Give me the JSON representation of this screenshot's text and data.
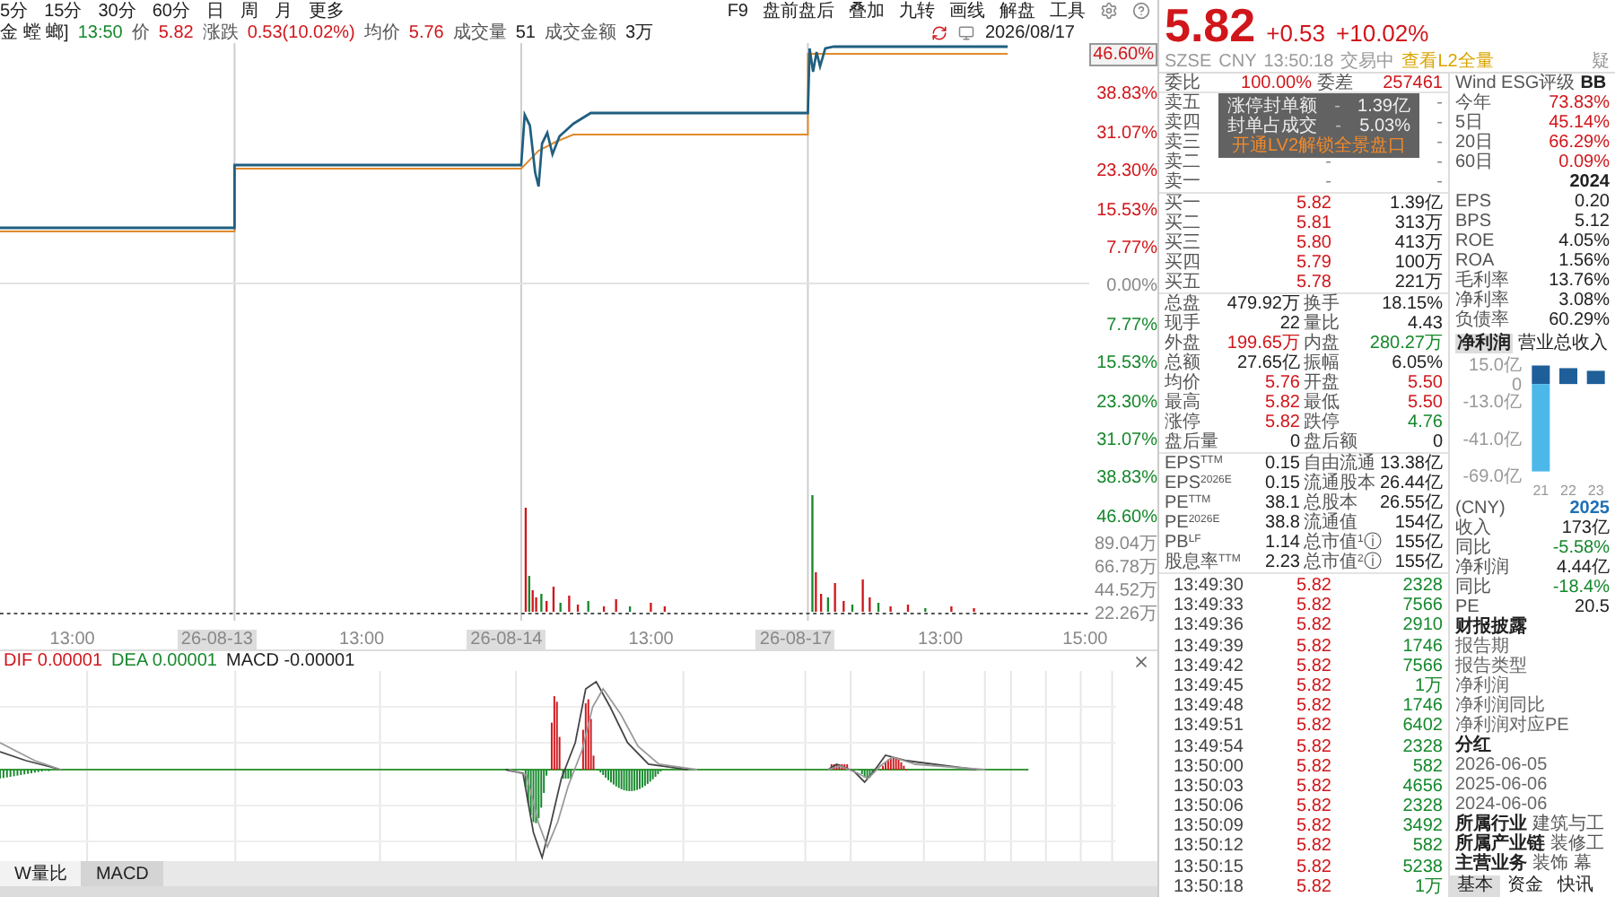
{
  "toolbar": {
    "periods": [
      {
        "label": "5分",
        "selected": false
      },
      {
        "label": "15分",
        "selected": false
      },
      {
        "label": "30分",
        "selected": false
      },
      {
        "label": "60分",
        "selected": false
      },
      {
        "label": "日",
        "selected": false
      },
      {
        "label": "周",
        "selected": false
      },
      {
        "label": "月",
        "selected": false
      },
      {
        "label": "更多",
        "selected": false
      }
    ],
    "tools": [
      "F9",
      "盘前盘后",
      "叠加",
      "九转",
      "画线",
      "解盘",
      "工具"
    ]
  },
  "quote_line": {
    "name": "金 螳 螂]",
    "time": "13:50",
    "items": [
      {
        "label": "价",
        "value": "5.82",
        "color": "#d0161b"
      },
      {
        "label": "涨跌",
        "value": "0.53(10.02%)",
        "color": "#d0161b"
      },
      {
        "label": "均价",
        "value": "5.76",
        "color": "#d0161b"
      },
      {
        "label": "成交量",
        "value": "51",
        "color": "#222222"
      },
      {
        "label": "成交金额",
        "value": "3万",
        "color": "#222222"
      }
    ],
    "date": "2026/08/17"
  },
  "price_axis": [
    {
      "label": "46.60%",
      "color": "#d0161b"
    },
    {
      "label": "38.83%",
      "color": "#d0161b"
    },
    {
      "label": "31.07%",
      "color": "#d0161b"
    },
    {
      "label": "23.30%",
      "color": "#d0161b"
    },
    {
      "label": "15.53%",
      "color": "#d0161b"
    },
    {
      "label": "7.77%",
      "color": "#d0161b"
    },
    {
      "label": "0.00%",
      "color": "#888888"
    },
    {
      "label": "7.77%",
      "color": "#15882c"
    },
    {
      "label": "15.53%",
      "color": "#15882c"
    },
    {
      "label": "23.30%",
      "color": "#15882c"
    },
    {
      "label": "31.07%",
      "color": "#15882c"
    },
    {
      "label": "38.83%",
      "color": "#15882c"
    },
    {
      "label": "46.60%",
      "color": "#15882c"
    }
  ],
  "volume_axis": [
    "89.04万",
    "66.78万",
    "44.52万",
    "22.26万"
  ],
  "x_axis": [
    {
      "label": "13:00",
      "kind": "time"
    },
    {
      "label": "26-08-13",
      "kind": "date"
    },
    {
      "label": "13:00",
      "kind": "time"
    },
    {
      "label": "26-08-14",
      "kind": "date"
    },
    {
      "label": "13:00",
      "kind": "time"
    },
    {
      "label": "26-08-17",
      "kind": "date"
    },
    {
      "label": "13:00",
      "kind": "time"
    },
    {
      "label": "15:00",
      "kind": "time"
    }
  ],
  "macd": [
    {
      "text": "DIF 0.00001",
      "color": "#d0161b"
    },
    {
      "text": "DEA 0.00001",
      "color": "#15882c"
    },
    {
      "text": "MACD -0.00001",
      "color": "#222222"
    }
  ],
  "indicator_tabs": [
    {
      "label": "W量比",
      "selected": false
    },
    {
      "label": "MACD",
      "selected": true
    }
  ],
  "quote": {
    "price": "5.82",
    "change": "+0.53",
    "percent": "+10.02%",
    "info": [
      "SZSE",
      "CNY",
      "13:50:18",
      "交易中"
    ],
    "l2_link": "查看L2全量",
    "edge_text": "疑"
  },
  "order_book": {
    "ratio": {
      "label": "委比",
      "value": "100.00%",
      "label2": "委差",
      "value2": "257461"
    },
    "asks": [
      {
        "label": "卖五",
        "volume": "-"
      },
      {
        "label": "卖四",
        "volume": "-"
      },
      {
        "label": "卖三",
        "volume": "-"
      },
      {
        "label": "卖二",
        "price": "-",
        "volume": "-"
      },
      {
        "label": "卖一",
        "price": "-",
        "volume": "-"
      }
    ],
    "bids": [
      {
        "label": "买一",
        "price": "5.82",
        "volume": "1.39亿"
      },
      {
        "label": "买二",
        "price": "5.81",
        "volume": "313万"
      },
      {
        "label": "买三",
        "price": "5.80",
        "volume": "413万"
      },
      {
        "label": "买四",
        "price": "5.79",
        "volume": "100万"
      },
      {
        "label": "买五",
        "price": "5.78",
        "volume": "221万"
      }
    ],
    "popup": {
      "rows": [
        {
          "label": "涨停封单额",
          "mid": "-",
          "value": "1.39亿"
        },
        {
          "label": "封单占成交",
          "mid": "-",
          "value": "5.03%"
        }
      ],
      "upgrade": "开通LV2解锁全景盘口"
    }
  },
  "stats": [
    [
      {
        "label": "总盘",
        "value": "479.92万",
        "color": "#222222"
      },
      {
        "label": "换手",
        "value": "18.15%",
        "color": "#222222"
      }
    ],
    [
      {
        "label": "现手",
        "value": "22",
        "color": "#222222"
      },
      {
        "label": "量比",
        "value": "4.43",
        "color": "#222222"
      }
    ],
    [
      {
        "label": "外盘",
        "value": "199.65万",
        "color": "#d0161b"
      },
      {
        "label": "内盘",
        "value": "280.27万",
        "color": "#15882c"
      }
    ],
    [
      {
        "label": "总额",
        "value": "27.65亿",
        "color": "#222222"
      },
      {
        "label": "振幅",
        "value": "6.05%",
        "color": "#222222"
      }
    ],
    [
      {
        "label": "均价",
        "value": "5.76",
        "color": "#d0161b"
      },
      {
        "label": "开盘",
        "value": "5.50",
        "color": "#d0161b"
      }
    ],
    [
      {
        "label": "最高",
        "value": "5.82",
        "color": "#d0161b"
      },
      {
        "label": "最低",
        "value": "5.50",
        "color": "#d0161b"
      }
    ],
    [
      {
        "label": "涨停",
        "value": "5.82",
        "color": "#d0161b"
      },
      {
        "label": "跌停",
        "value": "4.76",
        "color": "#15882c"
      }
    ],
    [
      {
        "label": "盘后量",
        "value": "0",
        "color": "#222222"
      },
      {
        "label": "盘后额",
        "value": "0",
        "color": "#222222"
      }
    ]
  ],
  "fundamentals": [
    [
      {
        "label": "EPS$^{TTM}$",
        "value": "0.15"
      },
      {
        "label": "自由流通",
        "value": "13.38亿"
      }
    ],
    [
      {
        "label": "EPS$^{2026E}$",
        "value": "0.15"
      },
      {
        "label": "流通股本",
        "value": "26.44亿"
      }
    ],
    [
      {
        "label": "PE$^{TTM}$",
        "value": "38.1"
      },
      {
        "label": "总股本",
        "value": "26.55亿"
      }
    ],
    [
      {
        "label": "PE$^{2026E}$",
        "value": "38.8"
      },
      {
        "label": "流通值",
        "value": "154亿"
      }
    ],
    [
      {
        "label": "PB$^{LF}$",
        "value": "1.14"
      },
      {
        "label": "总市值$^{1}$ⓘ",
        "value": "155亿"
      }
    ],
    [
      {
        "label": "股息率$^{TTM}$",
        "value": "2.23"
      },
      {
        "label": "总市值$^{2}$ⓘ",
        "value": "155亿"
      }
    ]
  ],
  "ticks": [
    {
      "time": "13:49:30",
      "price": "5.82",
      "volume": "2328"
    },
    {
      "time": "13:49:33",
      "price": "5.82",
      "volume": "7566"
    },
    {
      "time": "13:49:36",
      "price": "5.82",
      "volume": "2910"
    },
    {
      "time": "13:49:39",
      "price": "5.82",
      "volume": "1746"
    },
    {
      "time": "13:49:42",
      "price": "5.82",
      "volume": "7566"
    },
    {
      "time": "13:49:45",
      "price": "5.82",
      "volume": "1万"
    },
    {
      "time": "13:49:48",
      "price": "5.82",
      "volume": "1746"
    },
    {
      "time": "13:49:51",
      "price": "5.82",
      "volume": "6402"
    },
    {
      "time": "13:49:54",
      "price": "5.82",
      "volume": "2328"
    },
    {
      "time": "13:50:00",
      "price": "5.82",
      "volume": "582"
    },
    {
      "time": "13:50:03",
      "price": "5.82",
      "volume": "4656"
    },
    {
      "time": "13:50:06",
      "price": "5.82",
      "volume": "2328"
    },
    {
      "time": "13:50:09",
      "price": "5.82",
      "volume": "3492"
    },
    {
      "time": "13:50:12",
      "price": "5.82",
      "volume": "582"
    },
    {
      "time": "13:50:15",
      "price": "5.82",
      "volume": "5238"
    },
    {
      "time": "13:50:18",
      "price": "5.82",
      "volume": "1万"
    }
  ],
  "side": {
    "esg": {
      "label": "Wind ESG评级",
      "value": "BB"
    },
    "returns": [
      {
        "label": "今年",
        "value": "73.83%"
      },
      {
        "label": "5日",
        "value": "45.14%"
      },
      {
        "label": "20日",
        "value": "66.29%"
      },
      {
        "label": "60日",
        "value": "0.09%"
      }
    ],
    "year": "2024",
    "metrics": [
      {
        "label": "EPS",
        "value": "0.20"
      },
      {
        "label": "BPS",
        "value": "5.12"
      },
      {
        "label": "ROE",
        "value": "4.05%"
      },
      {
        "label": "ROA",
        "value": "1.56%"
      },
      {
        "label": "毛利率",
        "value": "13.76%"
      },
      {
        "label": "净利率",
        "value": "3.08%"
      },
      {
        "label": "负债率",
        "value": "60.29%"
      }
    ],
    "chart_tabs": [
      {
        "label": "净利润",
        "selected": true
      },
      {
        "label": "营业总收入",
        "selected": false
      }
    ],
    "chart_data": {
      "type": "bar",
      "categories": [
        "21",
        "22",
        "23"
      ],
      "series": [
        {
          "color": "#1f5f99",
          "values": [
            14,
            12,
            10
          ]
        },
        {
          "color": "#4cb8ea",
          "values": [
            -66,
            null,
            null
          ]
        }
      ],
      "ylim": [
        -69,
        15
      ],
      "yticks": [
        {
          "value": 15,
          "label": "15.0亿"
        },
        {
          "value": 0,
          "label": "0"
        },
        {
          "value": -13,
          "label": "-13.0亿"
        },
        {
          "value": -41,
          "label": "-41.0亿"
        },
        {
          "value": -69,
          "label": "-69.0亿"
        }
      ]
    },
    "forecast_header": {
      "label": "(CNY)",
      "year": "2025"
    },
    "forecast": [
      {
        "label": "收入",
        "value": "173亿",
        "color": "#222222"
      },
      {
        "label": "同比",
        "value": "-5.58%",
        "color": "#15882c"
      },
      {
        "label": "净利润",
        "value": "4.44亿",
        "color": "#222222"
      },
      {
        "label": "同比",
        "value": "-18.4%",
        "color": "#15882c"
      },
      {
        "label": "PE",
        "value": "20.5",
        "color": "#222222"
      }
    ],
    "report": {
      "title": "财报披露",
      "items": [
        "报告期",
        "报告类型",
        "净利润",
        "净利润同比",
        "净利润对应PE"
      ]
    },
    "dividend": {
      "title": "分红",
      "items": [
        "2026-06-05",
        "2025-06-06",
        "2024-06-06"
      ]
    },
    "profile": [
      {
        "label": "所属行业",
        "value": "建筑与工"
      },
      {
        "label": "所属产业链",
        "value": "装修工"
      },
      {
        "label": "主营业务",
        "value": "装饰 幕"
      }
    ],
    "tabs": [
      {
        "label": "基本",
        "selected": true
      },
      {
        "label": "资金",
        "selected": false
      },
      {
        "label": "快讯",
        "selected": false
      }
    ]
  }
}
